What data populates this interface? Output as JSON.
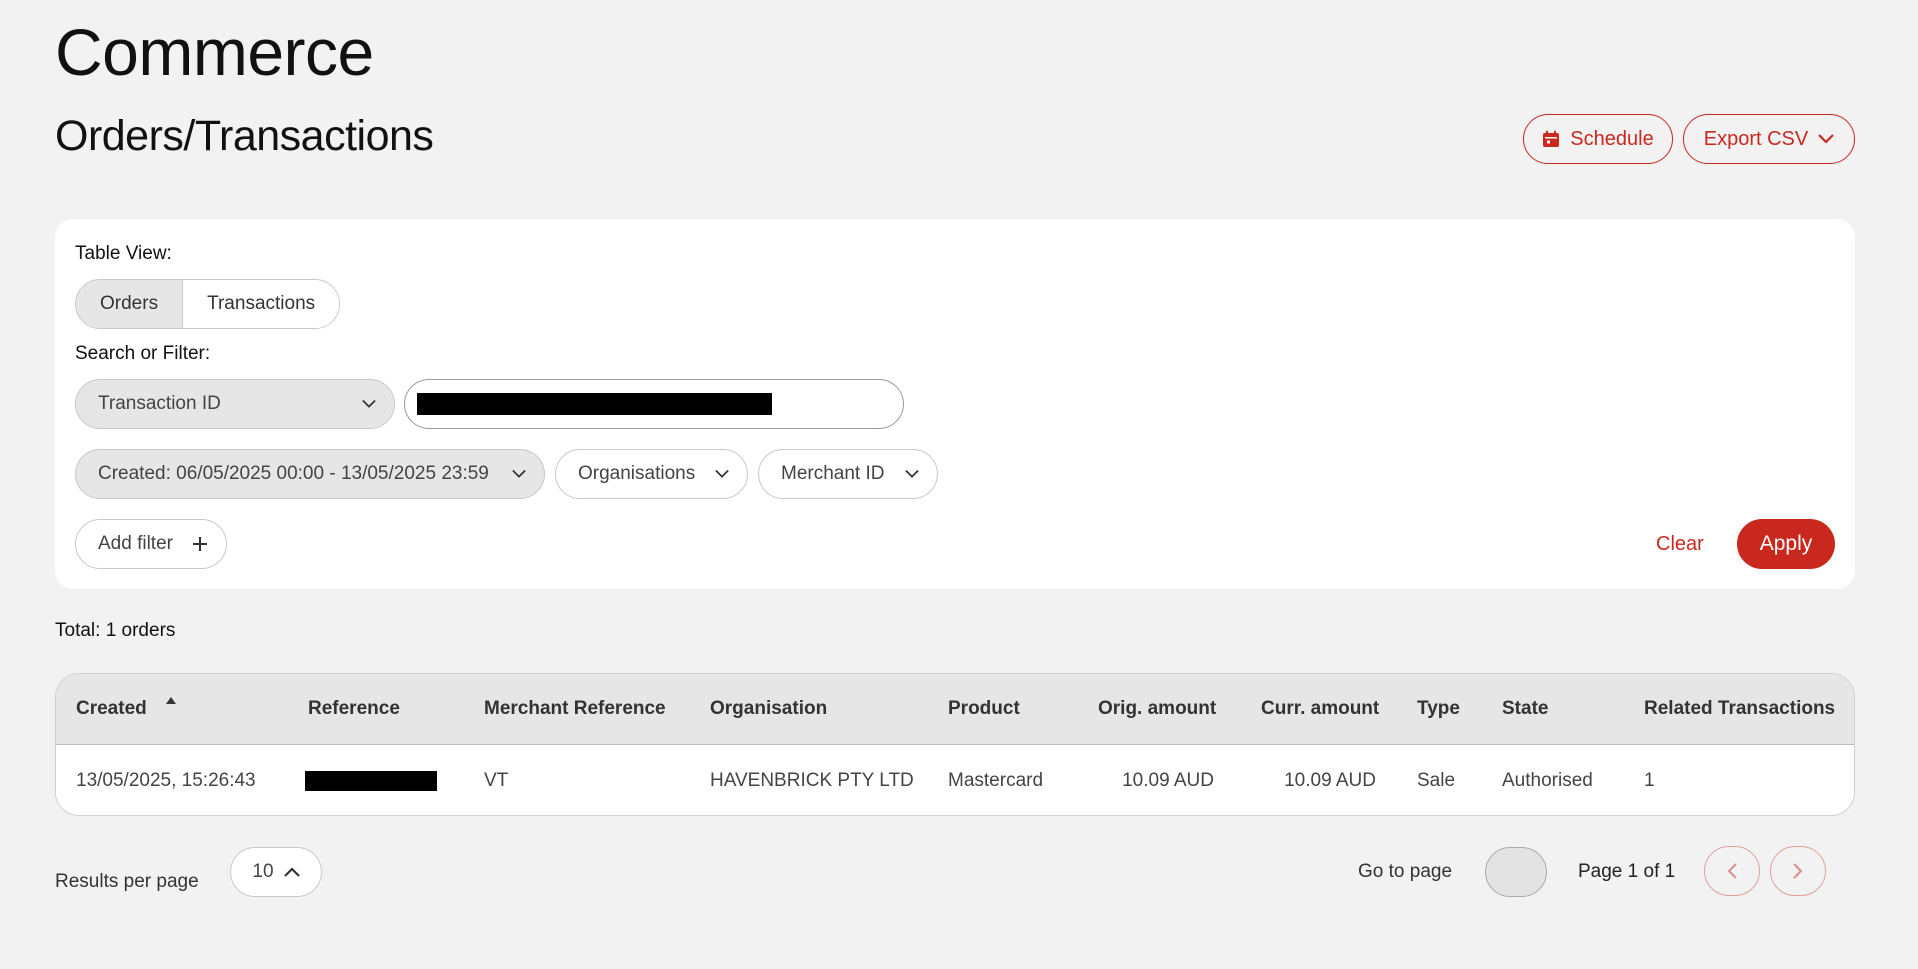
{
  "app": {
    "title": "Commerce"
  },
  "page": {
    "title": "Orders/Transactions"
  },
  "header_actions": {
    "schedule_label": "Schedule",
    "export_label": "Export CSV"
  },
  "filters": {
    "table_view_label": "Table View:",
    "view_tabs": [
      {
        "label": "Orders",
        "active": true
      },
      {
        "label": "Transactions",
        "active": false
      }
    ],
    "search_label": "Search or Filter:",
    "search_field_select": "Transaction ID",
    "search_value": "[redacted]",
    "chips": [
      {
        "label": "Created: 06/05/2025 00:00 - 13/05/2025 23:59"
      },
      {
        "label": "Organisations"
      },
      {
        "label": "Merchant ID"
      }
    ],
    "add_filter_label": "Add filter",
    "clear_label": "Clear",
    "apply_label": "Apply"
  },
  "summary": {
    "total_text": "Total: 1 orders"
  },
  "table": {
    "columns": [
      "Created",
      "Reference",
      "Merchant Reference",
      "Organisation",
      "Product",
      "Orig. amount",
      "Curr. amount",
      "Type",
      "State",
      "Related Transactions"
    ],
    "sort": {
      "column": "Created",
      "direction": "ascending"
    },
    "rows": [
      {
        "created": "13/05/2025, 15:26:43",
        "reference": "[redacted]",
        "merchant_reference": "VT",
        "organisation": "HAVENBRICK PTY LTD",
        "product": "Mastercard",
        "orig_amount": "10.09 AUD",
        "curr_amount": "10.09 AUD",
        "type": "Sale",
        "state": "Authorised",
        "related": "1"
      }
    ]
  },
  "pagination": {
    "rpp_label": "Results per page",
    "rpp_value": "10",
    "goto_label": "Go to page",
    "page_info": "Page 1 of 1"
  },
  "colors": {
    "accent": "#c8281e",
    "background": "#f2f2f2",
    "card": "#ffffff",
    "header_bg": "#e6e6e6"
  },
  "icons": [
    "calendar-icon",
    "chevron-down-icon",
    "plus-icon",
    "sort-asc-icon",
    "chevron-up-icon",
    "chevron-left-icon",
    "chevron-right-icon"
  ]
}
